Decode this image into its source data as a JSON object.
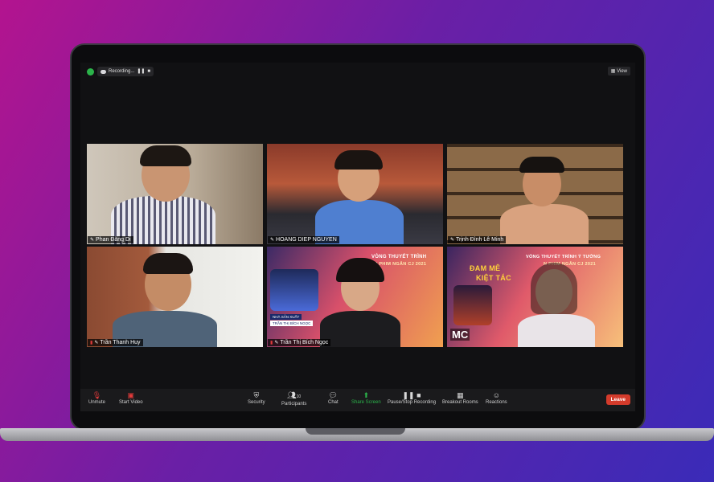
{
  "recording": {
    "label": "Recording...",
    "pause": "❚❚",
    "stop": "■"
  },
  "view_button": "View",
  "participants": [
    {
      "name": "Phan Đăng Di"
    },
    {
      "name": "HOANG DIEP NGUYEN"
    },
    {
      "name": "Trịnh Đình Lê Minh"
    },
    {
      "name": "Trần Thanh Huy"
    },
    {
      "name": "Trần Thị Bích Ngọc"
    },
    {
      "name": "MC"
    }
  ],
  "banners": {
    "tile5_line1": "VÒNG THUYẾT TRÌNH",
    "tile5_line2": "DỰ ÁN PHIM NGẮN CJ 2021",
    "tile5_badge1": "NHÀ SẢN XUẤT",
    "tile5_badge2": "TRẦN THỊ BÍCH NGỌC",
    "tile6_line1": "VÒNG THUYẾT TRÌNH Ý TƯỞNG",
    "tile6_line2": "N PHIM NGẮN CJ 2021",
    "tile6_line3": "ĐAM MÊ",
    "tile6_line4": "KIỆT TÁC"
  },
  "toolbar": {
    "unmute": "Unmute",
    "start_video": "Start Video",
    "security": "Security",
    "participants": "Participants",
    "participants_count": "10",
    "chat": "Chat",
    "share_screen": "Share Screen",
    "pause_stop_recording": "Pause/Stop Recording",
    "breakout_rooms": "Breakout Rooms",
    "reactions": "Reactions",
    "leave": "Leave"
  },
  "colors": {
    "share_screen_green": "#2bb34a",
    "leave_red": "#d43b2b",
    "muted_red": "#e03a3a"
  }
}
